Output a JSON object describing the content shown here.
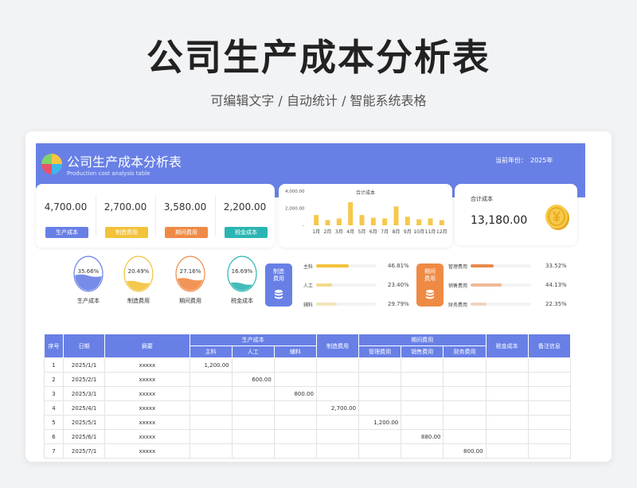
{
  "page": {
    "title": "公司生产成本分析表",
    "subtitle": "可编辑文字 / 自动统计 / 智能系统表格"
  },
  "sheet": {
    "title": "公司生产成本分析表",
    "subtitle": "Production cost analysis table",
    "year_label": "当前年份：",
    "year_value": "2025年"
  },
  "kpis": [
    {
      "value": "4,700.00",
      "label": "生产成本",
      "color": "#6880e6"
    },
    {
      "value": "2,700.00",
      "label": "制造费用",
      "color": "#f2c23a"
    },
    {
      "value": "3,580.00",
      "label": "期间费用",
      "color": "#ef8a45"
    },
    {
      "value": "2,200.00",
      "label": "税金成本",
      "color": "#2bb5b2"
    }
  ],
  "total": {
    "label": "合计成本",
    "value": "13,180.00"
  },
  "chart_data": {
    "type": "bar",
    "title": "合计成本",
    "categories": [
      "1月",
      "2月",
      "3月",
      "4月",
      "5月",
      "6月",
      "7月",
      "8月",
      "9月",
      "10月",
      "11月",
      "12月"
    ],
    "values": [
      1200,
      600,
      800,
      2700,
      1200,
      880,
      800,
      2200,
      1000,
      700,
      800,
      600
    ],
    "y_ticks": [
      "4,000.00",
      "2,000.00",
      "-"
    ],
    "ylim": [
      0,
      4000
    ],
    "bar_color": "#f6c84a"
  },
  "ratios": [
    {
      "label": "生产成本",
      "percent": "35.66%",
      "fill": 0.3566,
      "color": "#6880e6"
    },
    {
      "label": "制造费用",
      "percent": "20.49%",
      "fill": 0.2049,
      "color": "#f2c23a"
    },
    {
      "label": "期间费用",
      "percent": "27.16%",
      "fill": 0.2716,
      "color": "#ef8a45"
    },
    {
      "label": "税金成本",
      "percent": "16.69%",
      "fill": 0.1669,
      "color": "#2bb5b2"
    }
  ],
  "manufacturing": {
    "card_label": "制造\n费用",
    "color": "#6880e6",
    "bar_color": "#f2c23a",
    "rows": [
      {
        "label": "主料",
        "percent": "46.81%",
        "fill": 0.4681
      },
      {
        "label": "人工",
        "percent": "23.40%",
        "fill": 0.234
      },
      {
        "label": "辅料",
        "percent": "29.79%",
        "fill": 0.2979
      }
    ]
  },
  "period": {
    "card_label": "期间\n费用",
    "color": "#ef8a45",
    "bar_color": "#e78a4c",
    "rows": [
      {
        "label": "管理费用",
        "percent": "33.52%",
        "fill": 0.3352
      },
      {
        "label": "销售费用",
        "percent": "44.13%",
        "fill": 0.4413
      },
      {
        "label": "财务费用",
        "percent": "22.35%",
        "fill": 0.2235
      }
    ]
  },
  "table": {
    "headers": {
      "seq": "序号",
      "date": "日期",
      "summary": "摘要",
      "production": "生产成本",
      "main": "主料",
      "labor": "人工",
      "aux": "辅料",
      "manufacturing": "制造费用",
      "period": "期间费用",
      "admin": "管理费用",
      "sales": "销售费用",
      "finance": "财务费用",
      "tax": "税金成本",
      "notes": "备注信息"
    },
    "rows": [
      [
        "1",
        "2025/1/1",
        "xxxxx",
        "1,200.00",
        "",
        "",
        "",
        "",
        "",
        "",
        "",
        ""
      ],
      [
        "2",
        "2025/2/1",
        "xxxxx",
        "",
        "600.00",
        "",
        "",
        "",
        "",
        "",
        "",
        ""
      ],
      [
        "3",
        "2025/3/1",
        "xxxxx",
        "",
        "",
        "800.00",
        "",
        "",
        "",
        "",
        "",
        ""
      ],
      [
        "4",
        "2025/4/1",
        "xxxxx",
        "",
        "",
        "",
        "2,700.00",
        "",
        "",
        "",
        "",
        ""
      ],
      [
        "5",
        "2025/5/1",
        "xxxxx",
        "",
        "",
        "",
        "",
        "1,200.00",
        "",
        "",
        "",
        ""
      ],
      [
        "6",
        "2025/6/1",
        "xxxxx",
        "",
        "",
        "",
        "",
        "",
        "880.00",
        "",
        "",
        ""
      ],
      [
        "7",
        "2025/7/1",
        "xxxxx",
        "",
        "",
        "",
        "",
        "",
        "",
        "800.00",
        "",
        ""
      ]
    ]
  }
}
